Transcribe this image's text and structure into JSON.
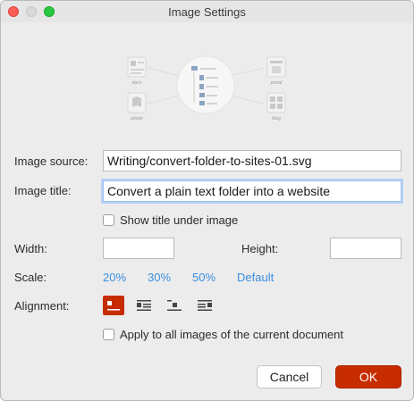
{
  "window": {
    "title": "Image Settings"
  },
  "illustration": {
    "labels": [
      "docs",
      "ebook",
      "portal",
      "blog"
    ]
  },
  "form": {
    "image_source_label": "Image source:",
    "image_source_value": "Writing/convert-folder-to-sites-01.svg",
    "image_title_label": "Image title:",
    "image_title_value": "Convert a plain text folder into a website",
    "show_title_label": "Show title under image",
    "show_title_checked": false,
    "width_label": "Width:",
    "width_value": "",
    "height_label": "Height:",
    "height_value": "",
    "scale_label": "Scale:",
    "scale_options": [
      "20%",
      "30%",
      "50%",
      "Default"
    ],
    "alignment_label": "Alignment:",
    "alignment_options": [
      "inline-left",
      "left",
      "center",
      "right"
    ],
    "alignment_selected": "inline-left",
    "apply_all_label": "Apply to all images of the current document",
    "apply_all_checked": false
  },
  "buttons": {
    "cancel": "Cancel",
    "ok": "OK"
  },
  "colors": {
    "accent": "#c72c00",
    "link": "#3b8fe0",
    "focus": "#b6d2f6"
  }
}
